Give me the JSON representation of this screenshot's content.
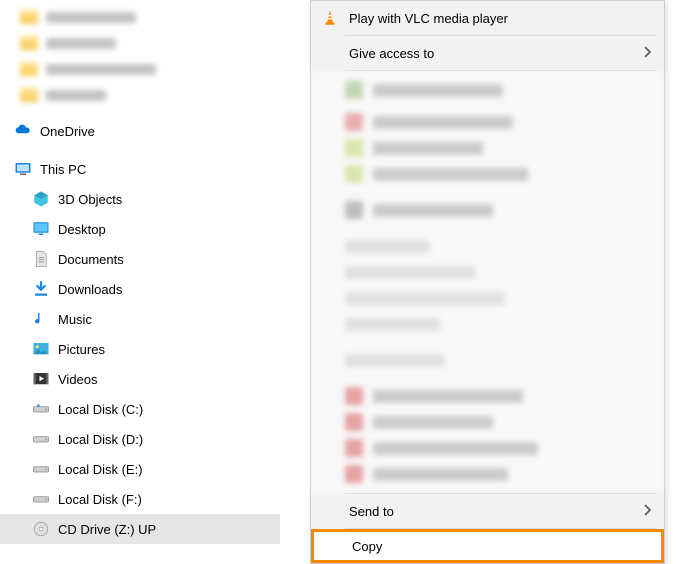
{
  "sidebar": {
    "onedrive": "OneDrive",
    "this_pc": "This PC",
    "items": [
      {
        "label": "3D Objects"
      },
      {
        "label": "Desktop"
      },
      {
        "label": "Documents"
      },
      {
        "label": "Downloads"
      },
      {
        "label": "Music"
      },
      {
        "label": "Pictures"
      },
      {
        "label": "Videos"
      },
      {
        "label": "Local Disk (C:)"
      },
      {
        "label": "Local Disk (D:)"
      },
      {
        "label": "Local Disk (E:)"
      },
      {
        "label": "Local Disk (F:)"
      },
      {
        "label": "CD Drive (Z:) UP"
      }
    ]
  },
  "context_menu": {
    "play_vlc": "Play with VLC media player",
    "give_access": "Give access to",
    "send_to": "Send to",
    "copy": "Copy"
  }
}
